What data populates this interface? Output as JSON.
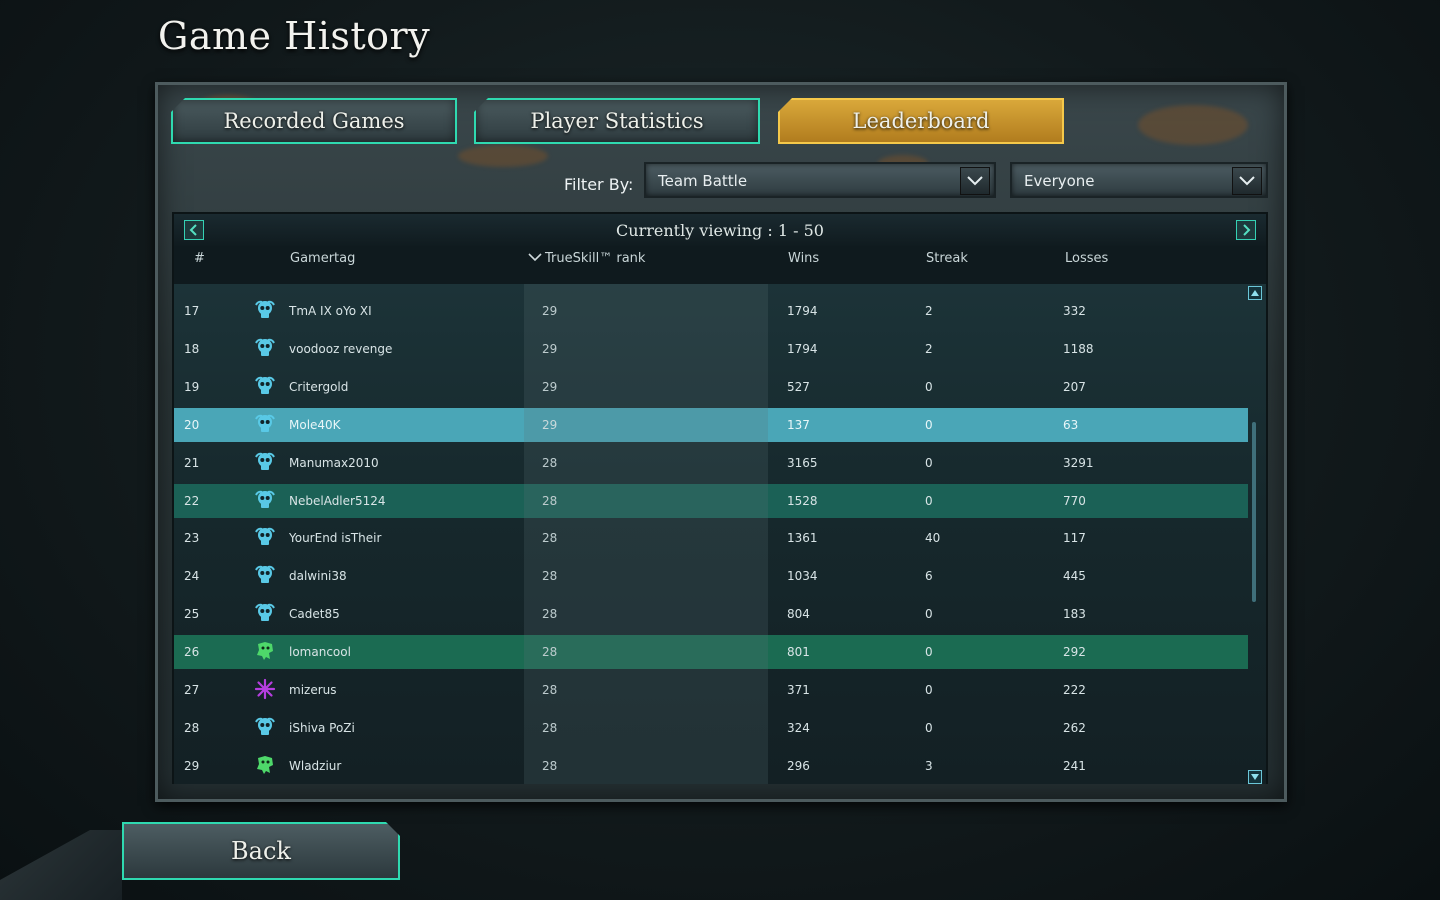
{
  "page": {
    "title": "Game History"
  },
  "tabs": [
    {
      "label": "Recorded Games",
      "active": false
    },
    {
      "label": "Player Statistics",
      "active": false
    },
    {
      "label": "Leaderboard",
      "active": true
    }
  ],
  "filter": {
    "label": "Filter By:",
    "mode": "Team Battle",
    "scope": "Everyone"
  },
  "viewing": {
    "text": "Currently viewing : 1 - 50"
  },
  "columns": {
    "rank_num": "#",
    "gamertag": "Gamertag",
    "trueskill": "TrueSkill™ rank",
    "wins": "Wins",
    "streak": "Streak",
    "losses": "Losses"
  },
  "rows": [
    {
      "num": "17",
      "gamertag": "TmA IX oYo XI",
      "trueskill": "29",
      "wins": "1794",
      "streak": "2",
      "losses": "332",
      "icon": "skull-icon",
      "style": ""
    },
    {
      "num": "18",
      "gamertag": "voodooz revenge",
      "trueskill": "29",
      "wins": "1794",
      "streak": "2",
      "losses": "1188",
      "icon": "skull-icon",
      "style": ""
    },
    {
      "num": "19",
      "gamertag": "Critergold",
      "trueskill": "29",
      "wins": "527",
      "streak": "0",
      "losses": "207",
      "icon": "skull-icon",
      "style": ""
    },
    {
      "num": "20",
      "gamertag": "Mole40K",
      "trueskill": "29",
      "wins": "137",
      "streak": "0",
      "losses": "63",
      "icon": "skull-icon",
      "style": "selected"
    },
    {
      "num": "21",
      "gamertag": "Manumax2010",
      "trueskill": "28",
      "wins": "3165",
      "streak": "0",
      "losses": "3291",
      "icon": "skull-icon",
      "style": ""
    },
    {
      "num": "22",
      "gamertag": "NebelAdler5124",
      "trueskill": "28",
      "wins": "1528",
      "streak": "0",
      "losses": "770",
      "icon": "skull-icon",
      "style": "friend"
    },
    {
      "num": "23",
      "gamertag": "YourEnd isTheir",
      "trueskill": "28",
      "wins": "1361",
      "streak": "40",
      "losses": "117",
      "icon": "skull-icon",
      "style": ""
    },
    {
      "num": "24",
      "gamertag": "dalwini38",
      "trueskill": "28",
      "wins": "1034",
      "streak": "6",
      "losses": "445",
      "icon": "skull-icon",
      "style": ""
    },
    {
      "num": "25",
      "gamertag": "Cadet85",
      "trueskill": "28",
      "wins": "804",
      "streak": "0",
      "losses": "183",
      "icon": "skull-icon",
      "style": ""
    },
    {
      "num": "26",
      "gamertag": "lomancool",
      "trueskill": "28",
      "wins": "801",
      "streak": "0",
      "losses": "292",
      "icon": "ork-icon",
      "style": "self"
    },
    {
      "num": "27",
      "gamertag": "mizerus",
      "trueskill": "28",
      "wins": "371",
      "streak": "0",
      "losses": "222",
      "icon": "chaos-star-icon",
      "style": ""
    },
    {
      "num": "28",
      "gamertag": "iShiva PoZi",
      "trueskill": "28",
      "wins": "324",
      "streak": "0",
      "losses": "262",
      "icon": "skull-icon",
      "style": ""
    },
    {
      "num": "29",
      "gamertag": "Wladziur",
      "trueskill": "28",
      "wins": "296",
      "streak": "3",
      "losses": "241",
      "icon": "ork-icon",
      "style": ""
    }
  ],
  "back": {
    "label": "Back"
  },
  "colors": {
    "accent": "#2fd9b0",
    "active_tab": "#d9a83a",
    "selected_row": "#4aa6b7",
    "friend_row": "#1b6156",
    "space_marine_icon": "#59c9e6",
    "ork_icon": "#4ed86a",
    "chaos_icon": "#b63ee0"
  }
}
